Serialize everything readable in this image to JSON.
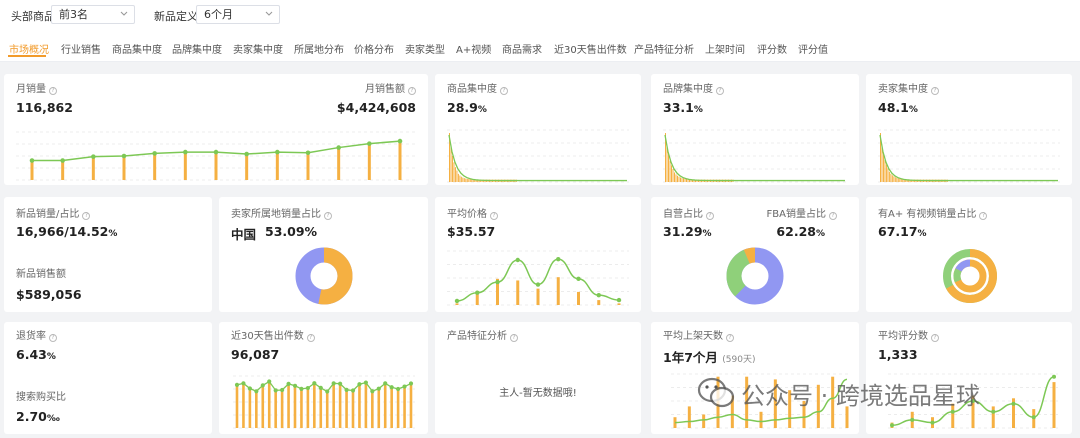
{
  "filters": {
    "top_products_label": "头部商品",
    "top_products_value": "前3名",
    "new_product_label": "新品定义",
    "new_product_value": "6个月"
  },
  "tabs": [
    "市场概况",
    "行业销售",
    "商品集中度",
    "品牌集中度",
    "卖家集中度",
    "所属地分布",
    "价格分布",
    "卖家类型",
    "A+视频",
    "商品需求",
    "近30天售出件数",
    "产品特征分析",
    "上架时间",
    "评分数",
    "评分值"
  ],
  "active_tab": "市场概况",
  "colors": {
    "accent": "#f29b2b",
    "bar": "#f5b042",
    "line": "#7dc855",
    "blue": "#9197f2",
    "green": "#8fd07a"
  },
  "cards": {
    "monthly_sales": {
      "label": "月销量",
      "value": "116,862",
      "revenue_label": "月销售额",
      "revenue_value": "$4,424,608",
      "chart_data": {
        "type": "bar",
        "bars": [
          3,
          3,
          3.6,
          3.7,
          4.1,
          4.3,
          4.3,
          4.0,
          4.3,
          4.2,
          5.0,
          5.6,
          6.0
        ],
        "line": [
          3,
          3,
          3.6,
          3.7,
          4.1,
          4.3,
          4.3,
          4.0,
          4.3,
          4.2,
          5.0,
          5.6,
          6.0
        ]
      }
    },
    "product_concentration": {
      "label": "商品集中度",
      "value": "28.9",
      "unit": "%"
    },
    "brand_concentration": {
      "label": "品牌集中度",
      "value": "33.1",
      "unit": "%"
    },
    "seller_concentration": {
      "label": "卖家集中度",
      "value": "48.1",
      "unit": "%"
    },
    "new_product": {
      "label": "新品销量/占比",
      "value": "16,966/14.52",
      "unit": "%",
      "revenue_label": "新品销售额",
      "revenue_value": "$589,056"
    },
    "seller_location": {
      "label": "卖家所属地销量占比",
      "country": "中国",
      "value": "53.09%",
      "chart_data": {
        "type": "pie",
        "values": [
          53.09,
          46.91
        ]
      }
    },
    "avg_price": {
      "label": "平均价格",
      "value": "$35.57",
      "chart_data": {
        "type": "bar",
        "bars": [
          0.2,
          1.5,
          3.2,
          3.0,
          2.0,
          3.4,
          1.6,
          0.6,
          0.2
        ],
        "line": [
          0.5,
          1.5,
          2.8,
          5.5,
          2.5,
          5.6,
          3.2,
          1.2,
          0.6
        ]
      }
    },
    "self_operated": {
      "label": "自营占比",
      "value": "31.29",
      "unit": "%",
      "fba_label": "FBA销量占比",
      "fba_value": "62.28",
      "fba_unit": "%",
      "chart_data": {
        "type": "pie",
        "values": [
          62.28,
          31.29,
          6.43
        ]
      }
    },
    "a_plus_video": {
      "label": "有A+ 有视频销量占比",
      "value": "67.17",
      "unit": "%",
      "chart_data": {
        "type": "pie",
        "values": [
          67.17,
          32.83
        ]
      }
    },
    "return_rate": {
      "label": "退货率",
      "value": "6.43",
      "unit": "%",
      "search_label": "搜索购买比",
      "search_value": "2.70",
      "search_unit": "‰"
    },
    "sold_30d": {
      "label": "近30天售出件数",
      "value": "96,087"
    },
    "product_feature": {
      "label": "产品特征分析",
      "empty_text": "主人-暂无数据哦!"
    },
    "avg_listing_days": {
      "label": "平均上架天数",
      "value": "1年7个月",
      "sub": "(590天)"
    },
    "avg_review_count": {
      "label": "平均评分数",
      "value": "1,333"
    }
  },
  "watermark": {
    "text": "公众号 · 跨境选品星球"
  }
}
